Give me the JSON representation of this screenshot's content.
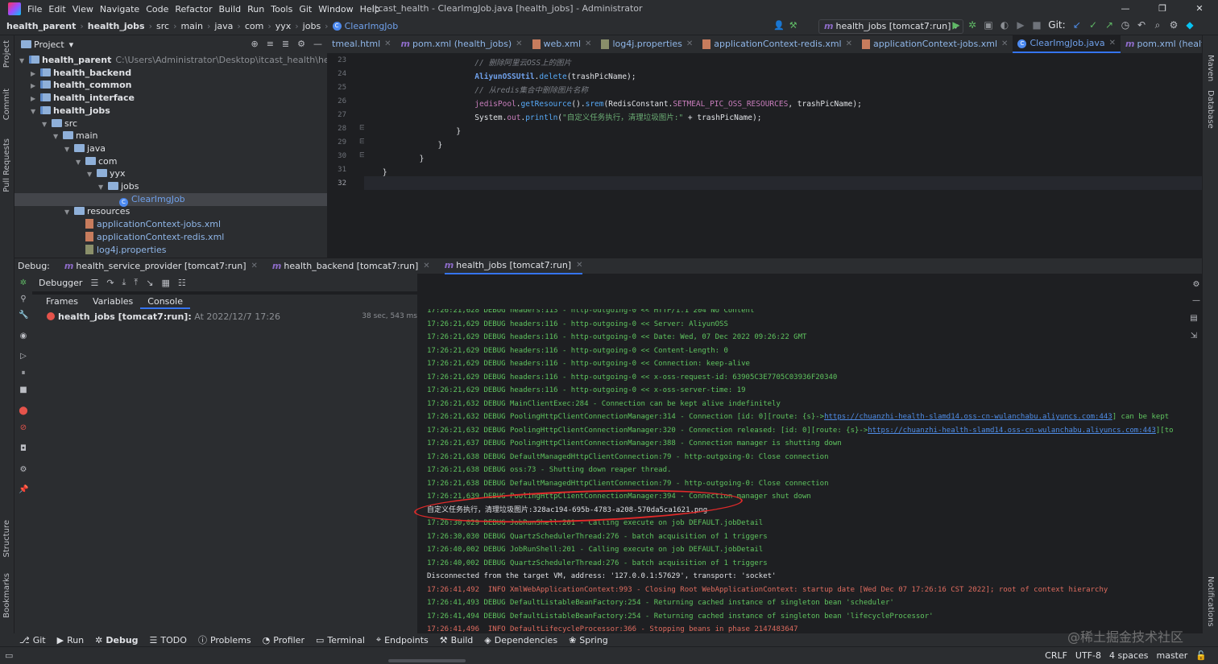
{
  "titlebar": {
    "menu": [
      "File",
      "Edit",
      "View",
      "Navigate",
      "Code",
      "Refactor",
      "Build",
      "Run",
      "Tools",
      "Git",
      "Window",
      "Help"
    ],
    "title": "itcast_health - ClearImgJob.java [health_jobs] - Administrator",
    "controls": [
      "—",
      "❐",
      "✕"
    ]
  },
  "navbar": {
    "crumbs": [
      "health_parent",
      "health_jobs",
      "src",
      "main",
      "java",
      "com",
      "yyx",
      "jobs",
      "ClearImgJob"
    ],
    "run_config": "health_jobs [tomcat7:run]",
    "git_label": "Git:"
  },
  "project": {
    "header": "Project",
    "tree": [
      {
        "label": "health_parent",
        "path": "C:\\Users\\Administrator\\Desktop\\itcast_health\\health_parent",
        "kind": "folder",
        "bold": true,
        "indent": 0,
        "open": true
      },
      {
        "label": "health_backend",
        "kind": "folder",
        "bold": true,
        "indent": 1,
        "open": false
      },
      {
        "label": "health_common",
        "kind": "folder",
        "bold": true,
        "indent": 1,
        "open": false
      },
      {
        "label": "health_interface",
        "kind": "folder",
        "bold": true,
        "indent": 1,
        "open": false
      },
      {
        "label": "health_jobs",
        "kind": "folder",
        "bold": true,
        "indent": 1,
        "open": true
      },
      {
        "label": "src",
        "kind": "folder",
        "indent": 2,
        "open": true
      },
      {
        "label": "main",
        "kind": "folder",
        "indent": 3,
        "open": true
      },
      {
        "label": "java",
        "kind": "folder",
        "indent": 4,
        "open": true
      },
      {
        "label": "com",
        "kind": "folder",
        "indent": 5,
        "open": true
      },
      {
        "label": "yyx",
        "kind": "folder",
        "indent": 6,
        "open": true
      },
      {
        "label": "jobs",
        "kind": "folder",
        "indent": 7,
        "open": true
      },
      {
        "label": "ClearImgJob",
        "kind": "class",
        "indent": 8,
        "selected": true
      },
      {
        "label": "resources",
        "kind": "folder",
        "indent": 4,
        "open": true
      },
      {
        "label": "applicationContext-jobs.xml",
        "kind": "xml",
        "indent": 5
      },
      {
        "label": "applicationContext-redis.xml",
        "kind": "xml",
        "indent": 5
      },
      {
        "label": "log4j.properties",
        "kind": "prop",
        "indent": 5
      }
    ]
  },
  "editor": {
    "tabs": [
      {
        "label": "tmeal.html",
        "kind": "html"
      },
      {
        "label": "pom.xml (health_jobs)",
        "kind": "maven"
      },
      {
        "label": "web.xml",
        "kind": "xml"
      },
      {
        "label": "log4j.properties",
        "kind": "prop"
      },
      {
        "label": "applicationContext-redis.xml",
        "kind": "xml"
      },
      {
        "label": "applicationContext-jobs.xml",
        "kind": "xml"
      },
      {
        "label": "ClearImgJob.java",
        "kind": "class",
        "active": true
      },
      {
        "label": "pom.xml (health_service_provider)",
        "kind": "maven"
      }
    ],
    "line_numbers": [
      "23",
      "24",
      "25",
      "26",
      "27",
      "28",
      "29",
      "30",
      "31",
      "32"
    ],
    "lines": [
      [
        {
          "t": "                        "
        },
        {
          "t": "// 删除阿里云OSS上的图片",
          "c": "cmt"
        }
      ],
      [
        {
          "t": "                        "
        },
        {
          "t": "AliyunOSSUtil",
          "c": "cls2"
        },
        {
          "t": ".",
          "c": "w"
        },
        {
          "t": "delete",
          "c": "mth"
        },
        {
          "t": "(trashPicName);",
          "c": "w"
        }
      ],
      [
        {
          "t": "                        "
        },
        {
          "t": "// 从redis集合中删除图片名称",
          "c": "cmt"
        }
      ],
      [
        {
          "t": "                        "
        },
        {
          "t": "jedisPool",
          "c": "fld"
        },
        {
          "t": ".",
          "c": "w"
        },
        {
          "t": "getResource",
          "c": "mth"
        },
        {
          "t": "().",
          "c": "w"
        },
        {
          "t": "srem",
          "c": "mth"
        },
        {
          "t": "(",
          "c": "w"
        },
        {
          "t": "RedisConstant",
          "c": "w"
        },
        {
          "t": ".",
          "c": "w"
        },
        {
          "t": "SETMEAL_PIC_OSS_RESOURCES",
          "c": "fld"
        },
        {
          "t": ", trashPicName);",
          "c": "w"
        }
      ],
      [
        {
          "t": "                        "
        },
        {
          "t": "System",
          "c": "w"
        },
        {
          "t": ".",
          "c": "w"
        },
        {
          "t": "out",
          "c": "fld"
        },
        {
          "t": ".",
          "c": "w"
        },
        {
          "t": "println",
          "c": "mth"
        },
        {
          "t": "(",
          "c": "w"
        },
        {
          "t": "\"自定义任务执行，清理垃圾图片:\"",
          "c": "str"
        },
        {
          "t": " + trashPicName);",
          "c": "w"
        }
      ],
      [
        {
          "t": "                    }",
          "c": "w"
        }
      ],
      [
        {
          "t": "                }",
          "c": "w"
        }
      ],
      [
        {
          "t": "            }",
          "c": "w"
        }
      ],
      [
        {
          "t": "    }",
          "c": "w"
        }
      ],
      [
        {
          "t": ""
        }
      ]
    ]
  },
  "debug": {
    "label": "Debug:",
    "tabs": [
      {
        "label": "health_service_provider [tomcat7:run]"
      },
      {
        "label": "health_backend [tomcat7:run]"
      },
      {
        "label": "health_jobs [tomcat7:run]",
        "active": true
      }
    ],
    "toolbar_label": "Debugger",
    "subtabs": [
      "Frames",
      "Variables",
      "Console"
    ],
    "session": {
      "name": "health_jobs [tomcat7:run]:",
      "time": "At 2022/12/7 17:26",
      "duration": "38 sec, 543 ms"
    }
  },
  "console": {
    "lines": [
      {
        "t": "17:26:21,628 DEBUG headers:113 - http-outgoing-0 << HTTP/1.1 204 No Content",
        "c": "g"
      },
      {
        "t": "17:26:21,629 DEBUG headers:116 - http-outgoing-0 << Server: AliyunOSS",
        "c": "g"
      },
      {
        "t": "17:26:21,629 DEBUG headers:116 - http-outgoing-0 << Date: Wed, 07 Dec 2022 09:26:22 GMT",
        "c": "g"
      },
      {
        "t": "17:26:21,629 DEBUG headers:116 - http-outgoing-0 << Content-Length: 0",
        "c": "g"
      },
      {
        "t": "17:26:21,629 DEBUG headers:116 - http-outgoing-0 << Connection: keep-alive",
        "c": "g"
      },
      {
        "t": "17:26:21,629 DEBUG headers:116 - http-outgoing-0 << x-oss-request-id: 63905C3E7705C03936F20340",
        "c": "g"
      },
      {
        "t": "17:26:21,629 DEBUG headers:116 - http-outgoing-0 << x-oss-server-time: 19",
        "c": "g"
      },
      {
        "t": "17:26:21,632 DEBUG MainClientExec:284 - Connection can be kept alive indefinitely",
        "c": "g"
      },
      {
        "t": "17:26:21,632 DEBUG PoolingHttpClientConnectionManager:314 - Connection [id: 0][route: {s}->",
        "link": "https://chuanzhi-health-slamd14.oss-cn-wulanchabu.aliyuncs.com:443",
        "tail": "] can be kept",
        "c": "g"
      },
      {
        "t": "17:26:21,632 DEBUG PoolingHttpClientConnectionManager:320 - Connection released: [id: 0][route: {s}->",
        "link": "https://chuanzhi-health-slamd14.oss-cn-wulanchabu.aliyuncs.com:443",
        "tail": "][to",
        "c": "g"
      },
      {
        "t": "17:26:21,637 DEBUG PoolingHttpClientConnectionManager:388 - Connection manager is shutting down",
        "c": "g"
      },
      {
        "t": "17:26:21,638 DEBUG DefaultManagedHttpClientConnection:79 - http-outgoing-0: Close connection",
        "c": "g"
      },
      {
        "t": "17:26:21,638 DEBUG oss:73 - Shutting down reaper thread.",
        "c": "g"
      },
      {
        "t": "17:26:21,638 DEBUG DefaultManagedHttpClientConnection:79 - http-outgoing-0: Close connection",
        "c": "g"
      },
      {
        "t": "17:26:21,639 DEBUG PoolingHttpClientConnectionManager:394 - Connection manager shut down",
        "c": "g"
      },
      {
        "t": "自定义任务执行，清理垃圾图片:328ac194-695b-4783-a208-570da5ca1621.png",
        "c": "w"
      },
      {
        "t": "17:26:30,029 DEBUG JobRunShell:201 - Calling execute on job DEFAULT.jobDetail",
        "c": "g"
      },
      {
        "t": "17:26:30,030 DEBUG QuartzSchedulerThread:276 - batch acquisition of 1 triggers",
        "c": "g"
      },
      {
        "t": "17:26:40,002 DEBUG JobRunShell:201 - Calling execute on job DEFAULT.jobDetail",
        "c": "g"
      },
      {
        "t": "17:26:40,002 DEBUG QuartzSchedulerThread:276 - batch acquisition of 1 triggers",
        "c": "g"
      },
      {
        "t": "Disconnected from the target VM, address: '127.0.0.1:57629', transport: 'socket'",
        "c": "w"
      },
      {
        "t": "17:26:41,492  INFO XmlWebApplicationContext:993 - Closing Root WebApplicationContext: startup date [Wed Dec 07 17:26:16 CST 2022]; root of context hierarchy",
        "c": "r"
      },
      {
        "t": "17:26:41,493 DEBUG DefaultListableBeanFactory:254 - Returning cached instance of singleton bean 'scheduler'",
        "c": "g"
      },
      {
        "t": "17:26:41,494 DEBUG DefaultListableBeanFactory:254 - Returning cached instance of singleton bean 'lifecycleProcessor'",
        "c": "g"
      },
      {
        "t": "17:26:41,496  INFO DefaultLifecycleProcessor:366 - Stopping beans in phase 2147483647",
        "c": "r"
      }
    ]
  },
  "bottom_tabs": [
    "Git",
    "Run",
    "Debug",
    "TODO",
    "Problems",
    "Profiler",
    "Terminal",
    "Endpoints",
    "Build",
    "Dependencies",
    "Spring"
  ],
  "bottom_active": "Debug",
  "left_strip": [
    "Project",
    "Commit",
    "Pull Requests",
    "Structure",
    "Bookmarks"
  ],
  "right_strip": [
    "Maven",
    "Database",
    "Notifications"
  ],
  "status": {
    "items": [
      "CRLF",
      "UTF-8",
      "4 spaces",
      "master"
    ]
  },
  "watermark": "@稀土掘金技术社区",
  "colors": {
    "accent": "#3574f0",
    "debug_green": "#5fc45f",
    "info_red": "#e06c5f",
    "annotation_red": "#e02a2a"
  }
}
